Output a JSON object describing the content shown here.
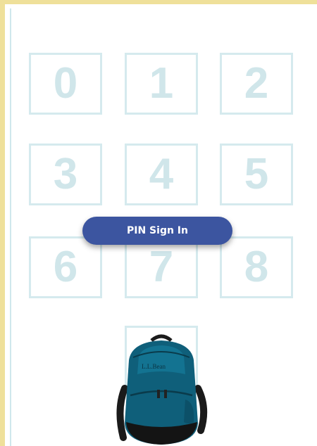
{
  "keypad": {
    "keys": [
      "0",
      "1",
      "2",
      "3",
      "4",
      "5",
      "6",
      "7",
      "8"
    ]
  },
  "pin_sign_in": {
    "label": "PIN Sign In"
  },
  "backpack_image": {
    "brand_text": "L.L.Bean"
  },
  "colors": {
    "border_accent": "#efe09a",
    "key_outline": "#d5eaee",
    "key_digit": "#d0e6ea",
    "button_bg": "#3c55a0",
    "backpack_teal": "#0f5f7a"
  }
}
